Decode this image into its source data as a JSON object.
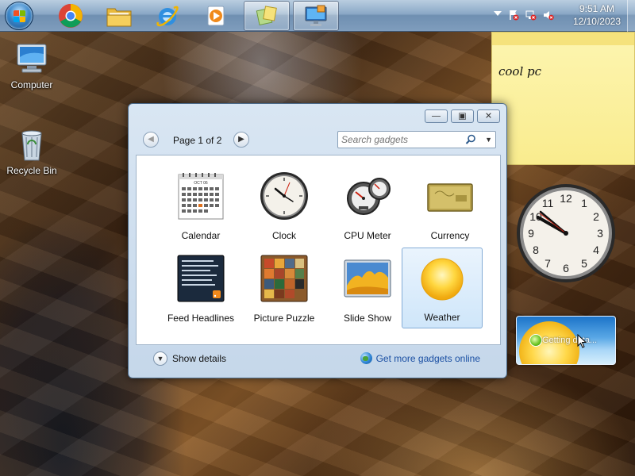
{
  "taskbar": {
    "pinned": [
      {
        "name": "start-button",
        "icon": "windows-flag-icon"
      },
      {
        "name": "chrome",
        "icon": "chrome-icon"
      },
      {
        "name": "explorer",
        "icon": "folder-icon"
      },
      {
        "name": "internet-explorer",
        "icon": "ie-icon"
      },
      {
        "name": "media-player",
        "icon": "media-player-icon"
      },
      {
        "name": "gadgets",
        "icon": "gadgets-icon"
      },
      {
        "name": "remote-desktop",
        "icon": "monitor-icon"
      }
    ],
    "clock": {
      "time": "9:51 AM",
      "date": "12/10/2023"
    }
  },
  "desktop_icons": [
    {
      "label": "Computer",
      "icon": "computer-icon"
    },
    {
      "label": "Recycle Bin",
      "icon": "recycle-bin-icon"
    }
  ],
  "sticky_note": {
    "text": "cool pc"
  },
  "weather_gadget": {
    "status": "Getting data..."
  },
  "gallery": {
    "page_label": "Page 1 of 2",
    "search_placeholder": "Search gadgets",
    "gadgets": [
      {
        "label": "Calendar",
        "icon": "calendar-icon",
        "month": "OCT 06"
      },
      {
        "label": "Clock",
        "icon": "clock-icon"
      },
      {
        "label": "CPU Meter",
        "icon": "cpu-meter-icon"
      },
      {
        "label": "Currency",
        "icon": "currency-icon"
      },
      {
        "label": "Feed Headlines",
        "icon": "feed-headlines-icon"
      },
      {
        "label": "Picture Puzzle",
        "icon": "picture-puzzle-icon"
      },
      {
        "label": "Slide Show",
        "icon": "slide-show-icon"
      },
      {
        "label": "Weather",
        "icon": "weather-icon",
        "selected": true
      }
    ],
    "show_details": "Show details",
    "get_more": "Get more gadgets online"
  },
  "colors": {
    "link": "#1a4fa3",
    "selection": "#cfe6fa",
    "taskbar": "#8aa8c6"
  }
}
